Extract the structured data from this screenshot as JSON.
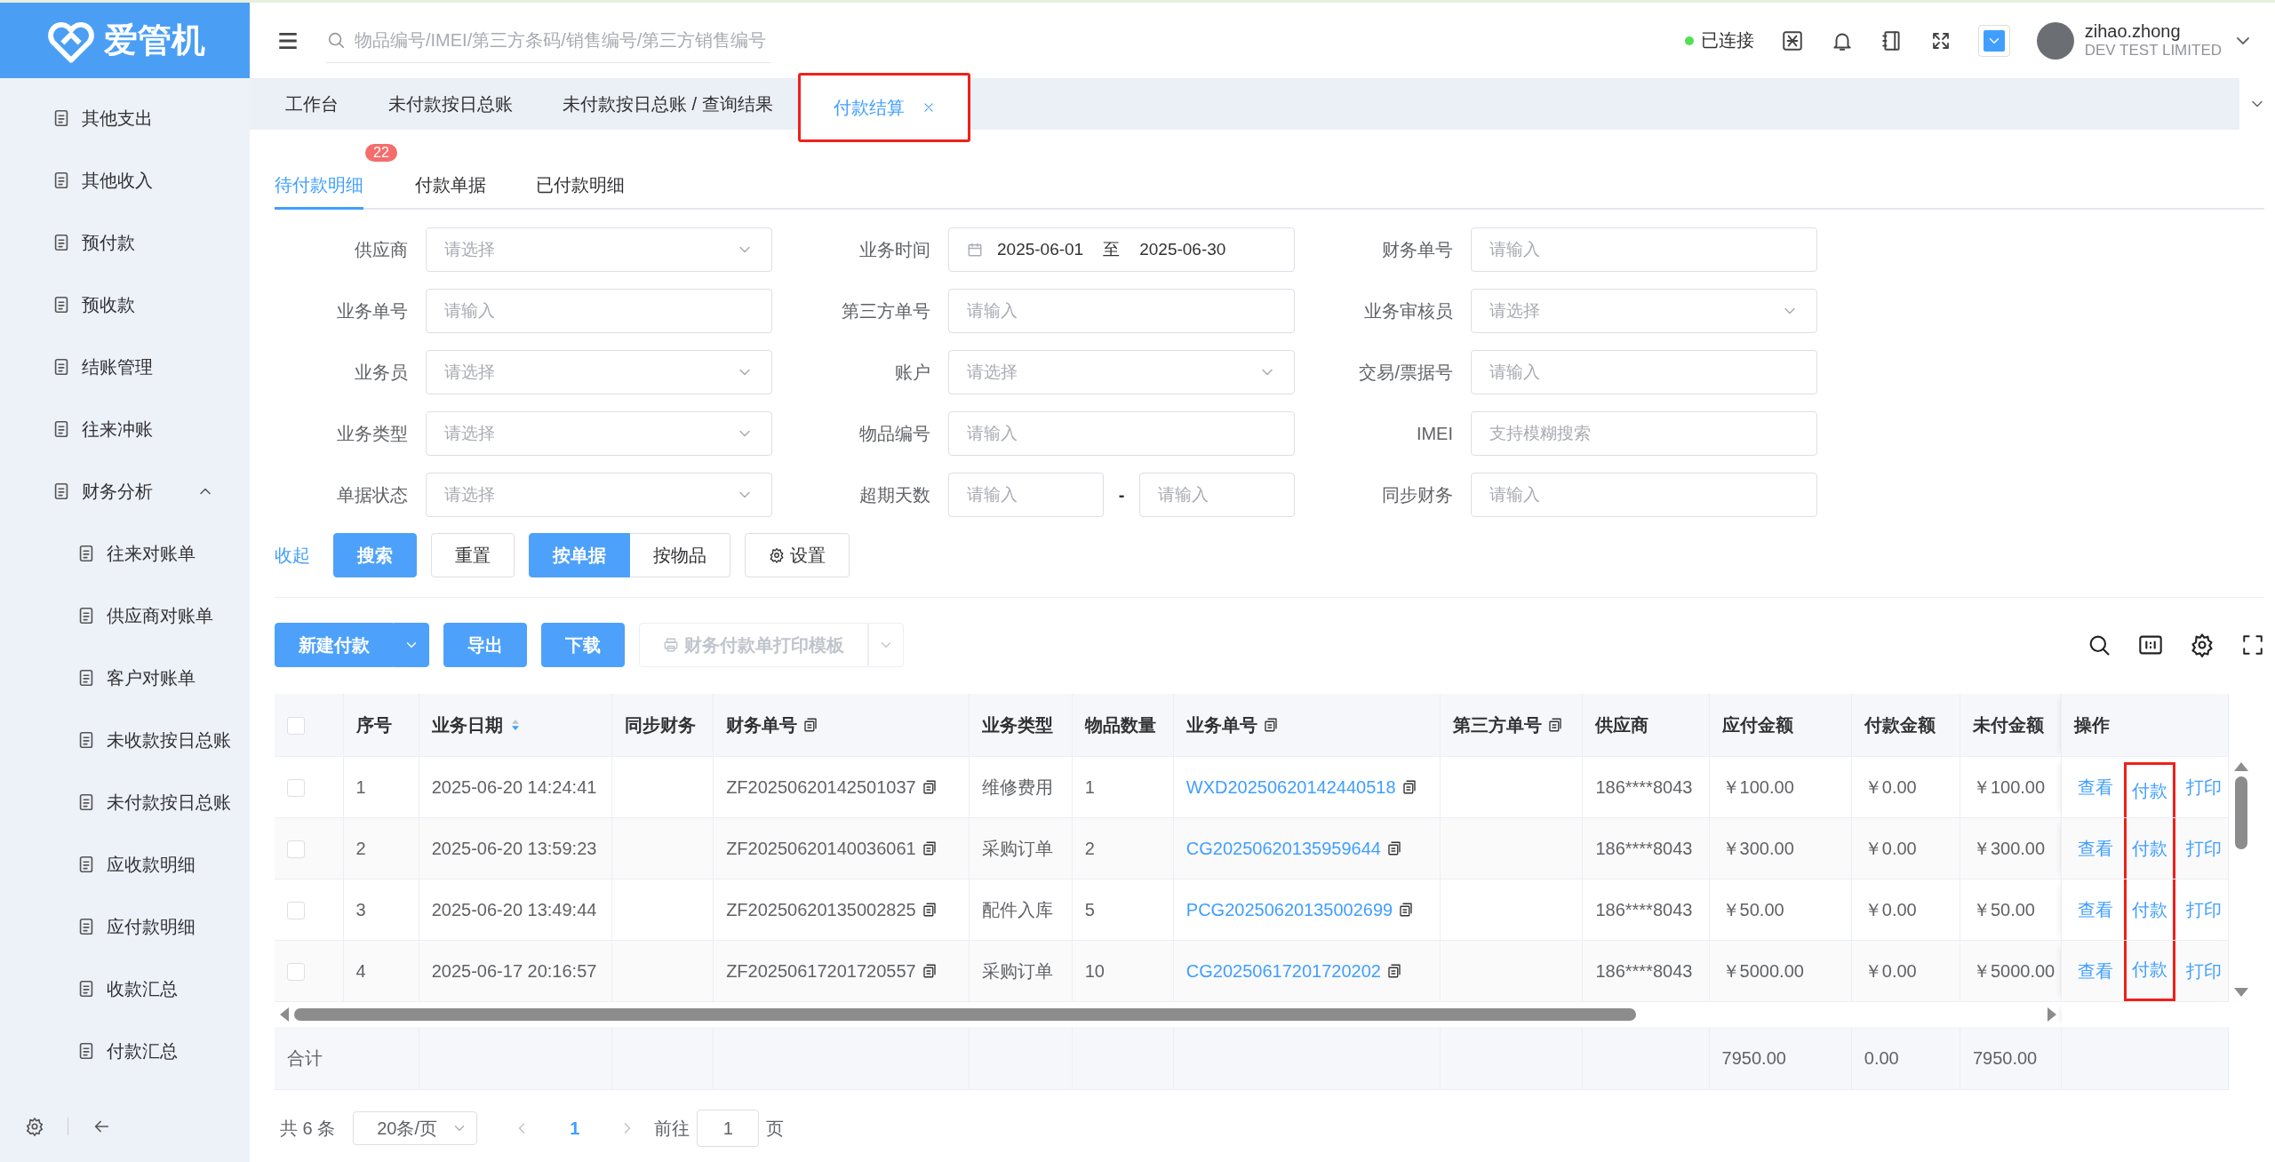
{
  "logo": {
    "text": "爱管机"
  },
  "sidebar": {
    "items": [
      {
        "label": "其他支出"
      },
      {
        "label": "其他收入"
      },
      {
        "label": "预付款"
      },
      {
        "label": "预收款"
      },
      {
        "label": "结账管理"
      },
      {
        "label": "往来冲账"
      },
      {
        "label": "财务分析",
        "expanded": true,
        "children": [
          {
            "label": "往来对账单"
          },
          {
            "label": "供应商对账单"
          },
          {
            "label": "客户对账单"
          },
          {
            "label": "未收款按日总账"
          },
          {
            "label": "未付款按日总账"
          },
          {
            "label": "应收款明细"
          },
          {
            "label": "应付款明细"
          },
          {
            "label": "收款汇总"
          },
          {
            "label": "付款汇总"
          }
        ]
      }
    ]
  },
  "header": {
    "search": {
      "placeholder": "物品编号/IMEI/第三方条码/销售编号/第三方销售编号"
    },
    "connection": {
      "label": "已连接",
      "connected": true
    },
    "user": {
      "name": "zihao.zhong",
      "company": "DEV TEST LIMITED"
    }
  },
  "tabs": [
    {
      "label": "工作台",
      "selected": false,
      "highlighted": false
    },
    {
      "label": "未付款按日总账",
      "selected": false,
      "highlighted": false
    },
    {
      "label": "未付款按日总账 / 查询结果",
      "selected": false,
      "highlighted": false
    },
    {
      "label": "付款结算",
      "selected": true,
      "highlighted": true,
      "closable": true
    }
  ],
  "subtabs": [
    {
      "label": "待付款明细",
      "selected": true,
      "badge": "22"
    },
    {
      "label": "付款单据",
      "selected": false
    },
    {
      "label": "已付款明细",
      "selected": false
    }
  ],
  "filters": [
    {
      "label": "供应商",
      "kind": "select",
      "placeholder": "请选择"
    },
    {
      "label": "业务时间",
      "kind": "date-range",
      "start": "2025-06-01",
      "separator": "至",
      "end": "2025-06-30"
    },
    {
      "label": "财务单号",
      "kind": "input",
      "placeholder": "请输入"
    },
    {
      "label": "业务单号",
      "kind": "input",
      "placeholder": "请输入"
    },
    {
      "label": "第三方单号",
      "kind": "input",
      "placeholder": "请输入"
    },
    {
      "label": "业务审核员",
      "kind": "select",
      "placeholder": "请选择"
    },
    {
      "label": "业务员",
      "kind": "select",
      "placeholder": "请选择"
    },
    {
      "label": "账户",
      "kind": "select",
      "placeholder": "请选择"
    },
    {
      "label": "交易/票据号",
      "kind": "input",
      "placeholder": "请输入"
    },
    {
      "label": "业务类型",
      "kind": "select",
      "placeholder": "请选择"
    },
    {
      "label": "物品编号",
      "kind": "input",
      "placeholder": "请输入"
    },
    {
      "label": "IMEI",
      "kind": "input",
      "placeholder": "支持模糊搜索"
    },
    {
      "label": "单据状态",
      "kind": "select",
      "placeholder": "请选择"
    },
    {
      "label": "超期天数",
      "kind": "number-range",
      "placeholder": "请输入",
      "separator": "-",
      "placeholder_end": "请输入"
    },
    {
      "label": "同步财务",
      "kind": "input",
      "placeholder": "请输入"
    }
  ],
  "filter_actions": {
    "collapse": "收起",
    "search": "搜索",
    "reset": "重置",
    "views": [
      {
        "label": "按单据",
        "selected": true
      },
      {
        "label": "按物品",
        "selected": false
      }
    ],
    "settings": "设置"
  },
  "toolbar": {
    "new_payment": "新建付款",
    "export": "导出",
    "download": "下载",
    "print_template": {
      "label": "财务付款单打印模板",
      "disabled": true
    }
  },
  "table": {
    "header_checked": false,
    "columns": [
      {
        "label": "序号"
      },
      {
        "label": "业务日期",
        "sort_descending": true
      },
      {
        "label": "同步财务"
      },
      {
        "label": "财务单号",
        "copyable": true
      },
      {
        "label": "业务类型"
      },
      {
        "label": "物品数量"
      },
      {
        "label": "业务单号",
        "copyable": true
      },
      {
        "label": "第三方单号",
        "copyable": true
      },
      {
        "label": "供应商"
      },
      {
        "label": "应付金额"
      },
      {
        "label": "付款金额"
      },
      {
        "label": "未付金额"
      },
      {
        "label": "操作"
      }
    ],
    "rows": [
      {
        "checked": false,
        "seq": "1",
        "date": "2025-06-20 14:24:41",
        "finance_no": "ZF20250620142501037",
        "type": "维修费用",
        "qty": "1",
        "business_no": "WXD20250620142440518",
        "supplier": "186****8043",
        "payable": "￥100.00",
        "paid": "￥0.00",
        "unpaid": "￥100.00",
        "actions": [
          {
            "label": "查看",
            "highlighted": false
          },
          {
            "label": "付款",
            "highlighted": true
          },
          {
            "label": "打印",
            "highlighted": false
          }
        ]
      },
      {
        "checked": false,
        "seq": "2",
        "date": "2025-06-20 13:59:23",
        "finance_no": "ZF20250620140036061",
        "type": "采购订单",
        "qty": "2",
        "business_no": "CG20250620135959644",
        "supplier": "186****8043",
        "payable": "￥300.00",
        "paid": "￥0.00",
        "unpaid": "￥300.00",
        "actions": [
          {
            "label": "查看",
            "highlighted": false
          },
          {
            "label": "付款",
            "highlighted": true
          },
          {
            "label": "打印",
            "highlighted": false
          }
        ]
      },
      {
        "checked": false,
        "seq": "3",
        "date": "2025-06-20 13:49:44",
        "finance_no": "ZF20250620135002825",
        "type": "配件入库",
        "qty": "5",
        "business_no": "PCG20250620135002699",
        "supplier": "186****8043",
        "payable": "￥50.00",
        "paid": "￥0.00",
        "unpaid": "￥50.00",
        "actions": [
          {
            "label": "查看",
            "highlighted": false
          },
          {
            "label": "付款",
            "highlighted": true
          },
          {
            "label": "打印",
            "highlighted": false
          }
        ]
      },
      {
        "checked": false,
        "seq": "4",
        "date": "2025-06-17 20:16:57",
        "finance_no": "ZF20250617201720557",
        "type": "采购订单",
        "qty": "10",
        "business_no": "CG20250617201720202",
        "supplier": "186****8043",
        "payable": "￥5000.00",
        "paid": "￥0.00",
        "unpaid": "￥5000.00",
        "actions": [
          {
            "label": "查看",
            "highlighted": false
          },
          {
            "label": "付款",
            "highlighted": true
          },
          {
            "label": "打印",
            "highlighted": false
          }
        ]
      }
    ],
    "totals": {
      "label": "合计",
      "payable": "7950.00",
      "paid": "0.00",
      "unpaid": "7950.00"
    }
  },
  "pagination": {
    "total": "共 6 条",
    "page_size": "20条/页",
    "current": "1",
    "goto_label": "前往",
    "goto_value": "1",
    "page_suffix": "页"
  }
}
